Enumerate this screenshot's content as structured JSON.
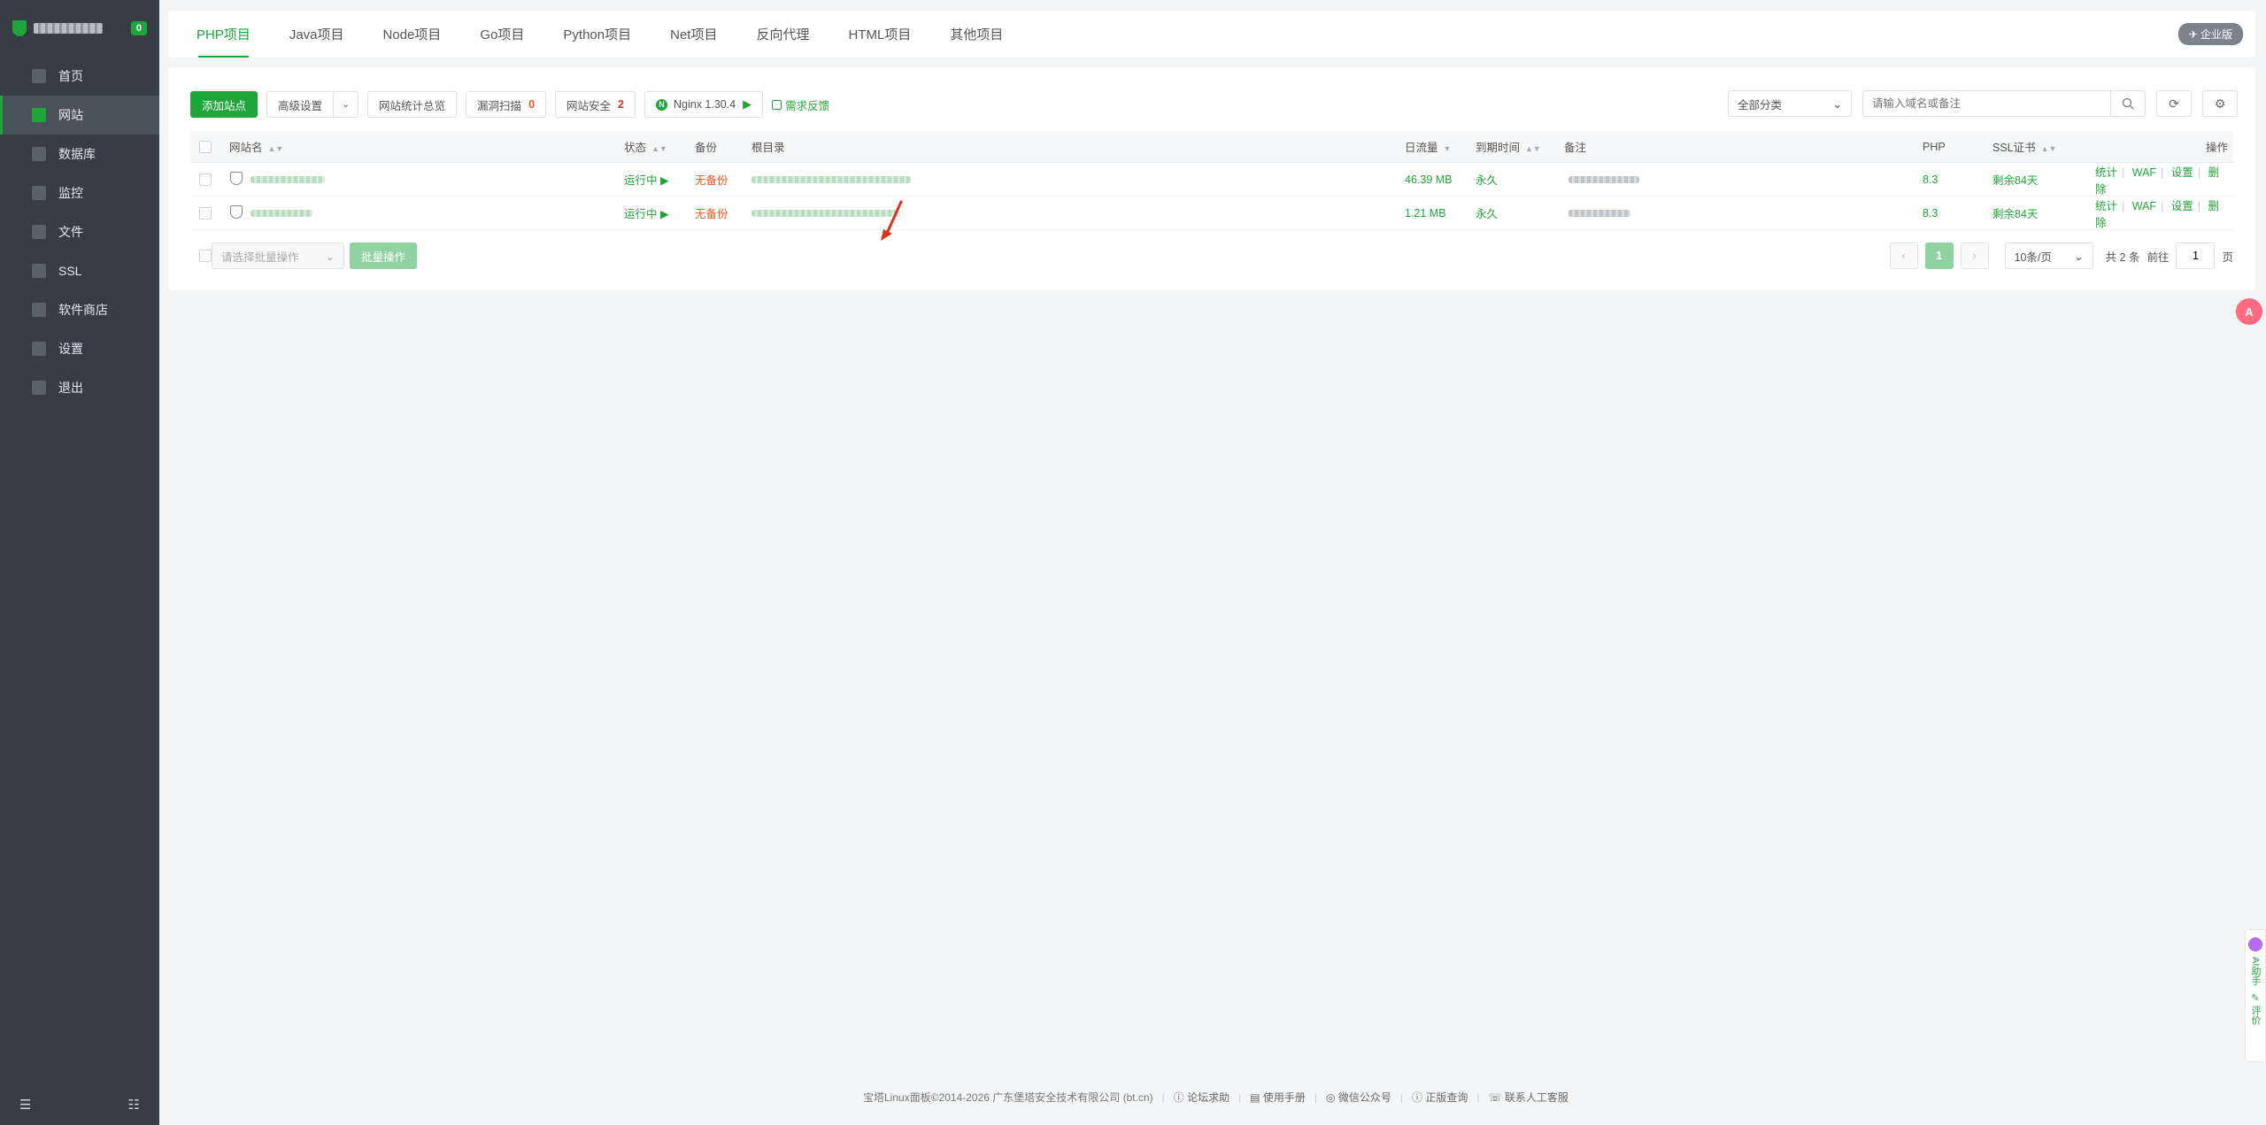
{
  "sidebar": {
    "badge": "0",
    "items": [
      {
        "label": "首页",
        "icon": "home-icon"
      },
      {
        "label": "网站",
        "icon": "website-icon",
        "active": true
      },
      {
        "label": "数据库",
        "icon": "database-icon"
      },
      {
        "label": "监控",
        "icon": "monitor-icon"
      },
      {
        "label": "文件",
        "icon": "file-icon"
      },
      {
        "label": "SSL",
        "icon": "ssl-icon"
      },
      {
        "label": "软件商店",
        "icon": "store-icon"
      },
      {
        "label": "设置",
        "icon": "settings-icon"
      },
      {
        "label": "退出",
        "icon": "logout-icon"
      }
    ]
  },
  "tabs": [
    "PHP项目",
    "Java项目",
    "Node项目",
    "Go项目",
    "Python项目",
    "Net项目",
    "反向代理",
    "HTML项目",
    "其他项目"
  ],
  "edition": "企业版",
  "toolbar": {
    "add_site": "添加站点",
    "advanced": "高级设置",
    "stats": "网站统计总览",
    "vuln_scan": "漏洞扫描",
    "vuln_count": "0",
    "site_security": "网站安全",
    "security_count": "2",
    "nginx": "Nginx 1.30.4",
    "feedback": "需求反馈",
    "category": "全部分类",
    "search_placeholder": "请输入域名或备注"
  },
  "table": {
    "headers": {
      "name": "网站名",
      "status": "状态",
      "backup": "备份",
      "root": "根目录",
      "traffic": "日流量",
      "expire": "到期时间",
      "note": "备注",
      "php": "PHP",
      "ssl": "SSL证书",
      "ops": "操作"
    },
    "rows": [
      {
        "status": "运行中",
        "backup": "无备份",
        "traffic": "46.39 MB",
        "expire": "永久",
        "php": "8.3",
        "ssl": "剩余84天"
      },
      {
        "status": "运行中",
        "backup": "无备份",
        "traffic": "1.21 MB",
        "expire": "永久",
        "php": "8.3",
        "ssl": "剩余84天"
      }
    ],
    "ops": [
      "统计",
      "WAF",
      "设置",
      "删除"
    ]
  },
  "batch": {
    "placeholder": "请选择批量操作",
    "button": "批量操作"
  },
  "pager": {
    "current": "1",
    "per_page": "10条/页",
    "total": "共 2 条",
    "goto": "前往",
    "goto_value": "1",
    "page_unit": "页"
  },
  "assistant": {
    "label": "AI助手",
    "rate": "评价"
  },
  "footer": {
    "copyright": "宝塔Linux面板©2014-2026 广东堡塔安全技术有限公司 (bt.cn)",
    "links": [
      "论坛求助",
      "使用手册",
      "微信公众号",
      "正版查询",
      "联系人工客服"
    ]
  },
  "colors": {
    "accent": "#20a53a",
    "warn": "#f0541e",
    "sidebar": "#363d45"
  }
}
